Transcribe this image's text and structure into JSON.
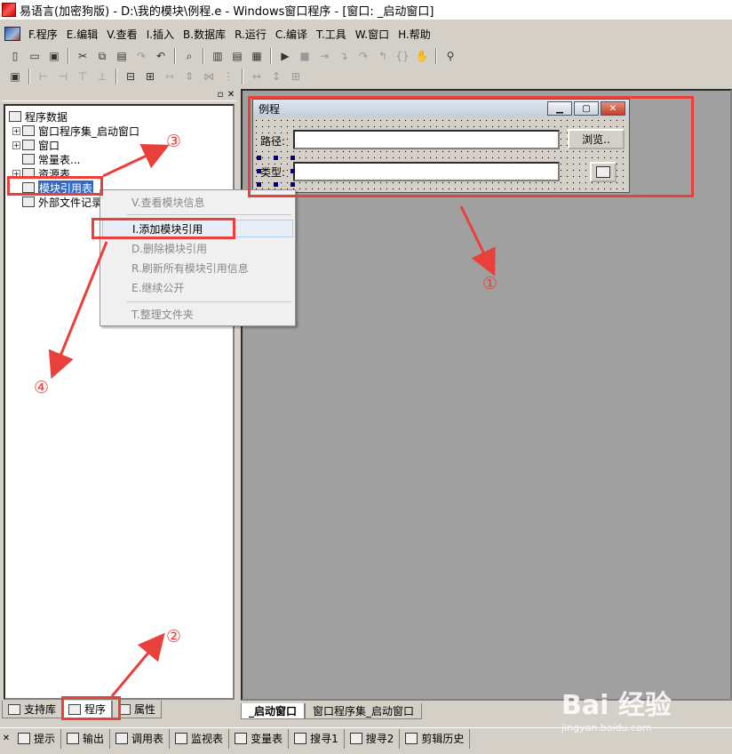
{
  "window": {
    "title": "易语言(加密狗版) - D:\\我的模块\\例程.e - Windows窗口程序 - [窗口: _启动窗口]"
  },
  "menu": [
    "F.程序",
    "E.编辑",
    "V.查看",
    "I.插入",
    "B.数据库",
    "R.运行",
    "C.编译",
    "T.工具",
    "W.窗口",
    "H.帮助"
  ],
  "tree": {
    "root": "程序数据",
    "items": [
      "窗口程序集_启动窗口",
      "窗口",
      "常量表...",
      "资源表",
      "模块引用表",
      "外部文件记录"
    ]
  },
  "left_tabs": [
    "支持库",
    "程序",
    "属性"
  ],
  "context_menu": [
    "V.查看模块信息",
    "I.添加模块引用",
    "D.删除模块引用",
    "R.刷新所有模块引用信息",
    "E.继续公开",
    "T.整理文件夹"
  ],
  "form": {
    "title": "例程",
    "path_label": "路径:",
    "browse_button": "浏览..",
    "type_label": "类型:"
  },
  "design_tabs": [
    "_启动窗口",
    "窗口程序集_启动窗口"
  ],
  "bottom_tabs": [
    "提示",
    "输出",
    "调用表",
    "监视表",
    "变量表",
    "搜寻1",
    "搜寻2",
    "剪辑历史"
  ],
  "annotations": [
    "①",
    "②",
    "③",
    "④"
  ],
  "watermark": {
    "line1": "Bai 经验",
    "line2": "jingyan.baidu.com"
  },
  "colors": {
    "annotation": "#e8413b",
    "selection": "#316ac5",
    "design_bg": "#a0a0a0"
  }
}
